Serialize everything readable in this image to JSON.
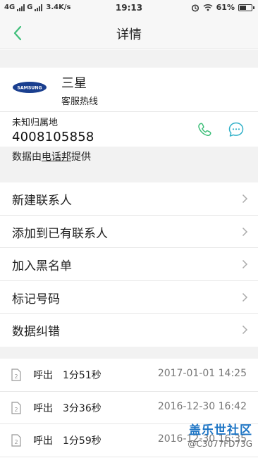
{
  "status_bar": {
    "network1": "4G",
    "network2": "G",
    "speed": "3.4K/s",
    "time": "19:13",
    "battery": "61%",
    "battery_level": 0.61
  },
  "header": {
    "title": "详情"
  },
  "contact": {
    "company": "三星",
    "subtitle": "客服热线",
    "logo_text": "SAMSUNG",
    "location": "未知归属地",
    "number": "4008105858",
    "provider_prefix": "数据由",
    "provider_link": "电话邦",
    "provider_suffix": "提供"
  },
  "menu": {
    "items": [
      {
        "label": "新建联系人"
      },
      {
        "label": "添加到已有联系人"
      },
      {
        "label": "加入黑名单"
      },
      {
        "label": "标记号码"
      },
      {
        "label": "数据纠错"
      }
    ]
  },
  "call_log": {
    "rows": [
      {
        "type": "呼出",
        "duration": "1分51秒",
        "datetime": "2017-01-01  14:25"
      },
      {
        "type": "呼出",
        "duration": "3分36秒",
        "datetime": "2016-12-30  16:42"
      },
      {
        "type": "呼出",
        "duration": "1分59秒",
        "datetime": "2016-12-30  16:35"
      }
    ]
  },
  "watermark": {
    "title": "盖乐世社区",
    "user": "@C3077FD73G"
  },
  "colors": {
    "accent_green": "#3fbf7a",
    "accent_teal": "#2fb0c8",
    "samsung_blue": "#1a3f8f"
  }
}
